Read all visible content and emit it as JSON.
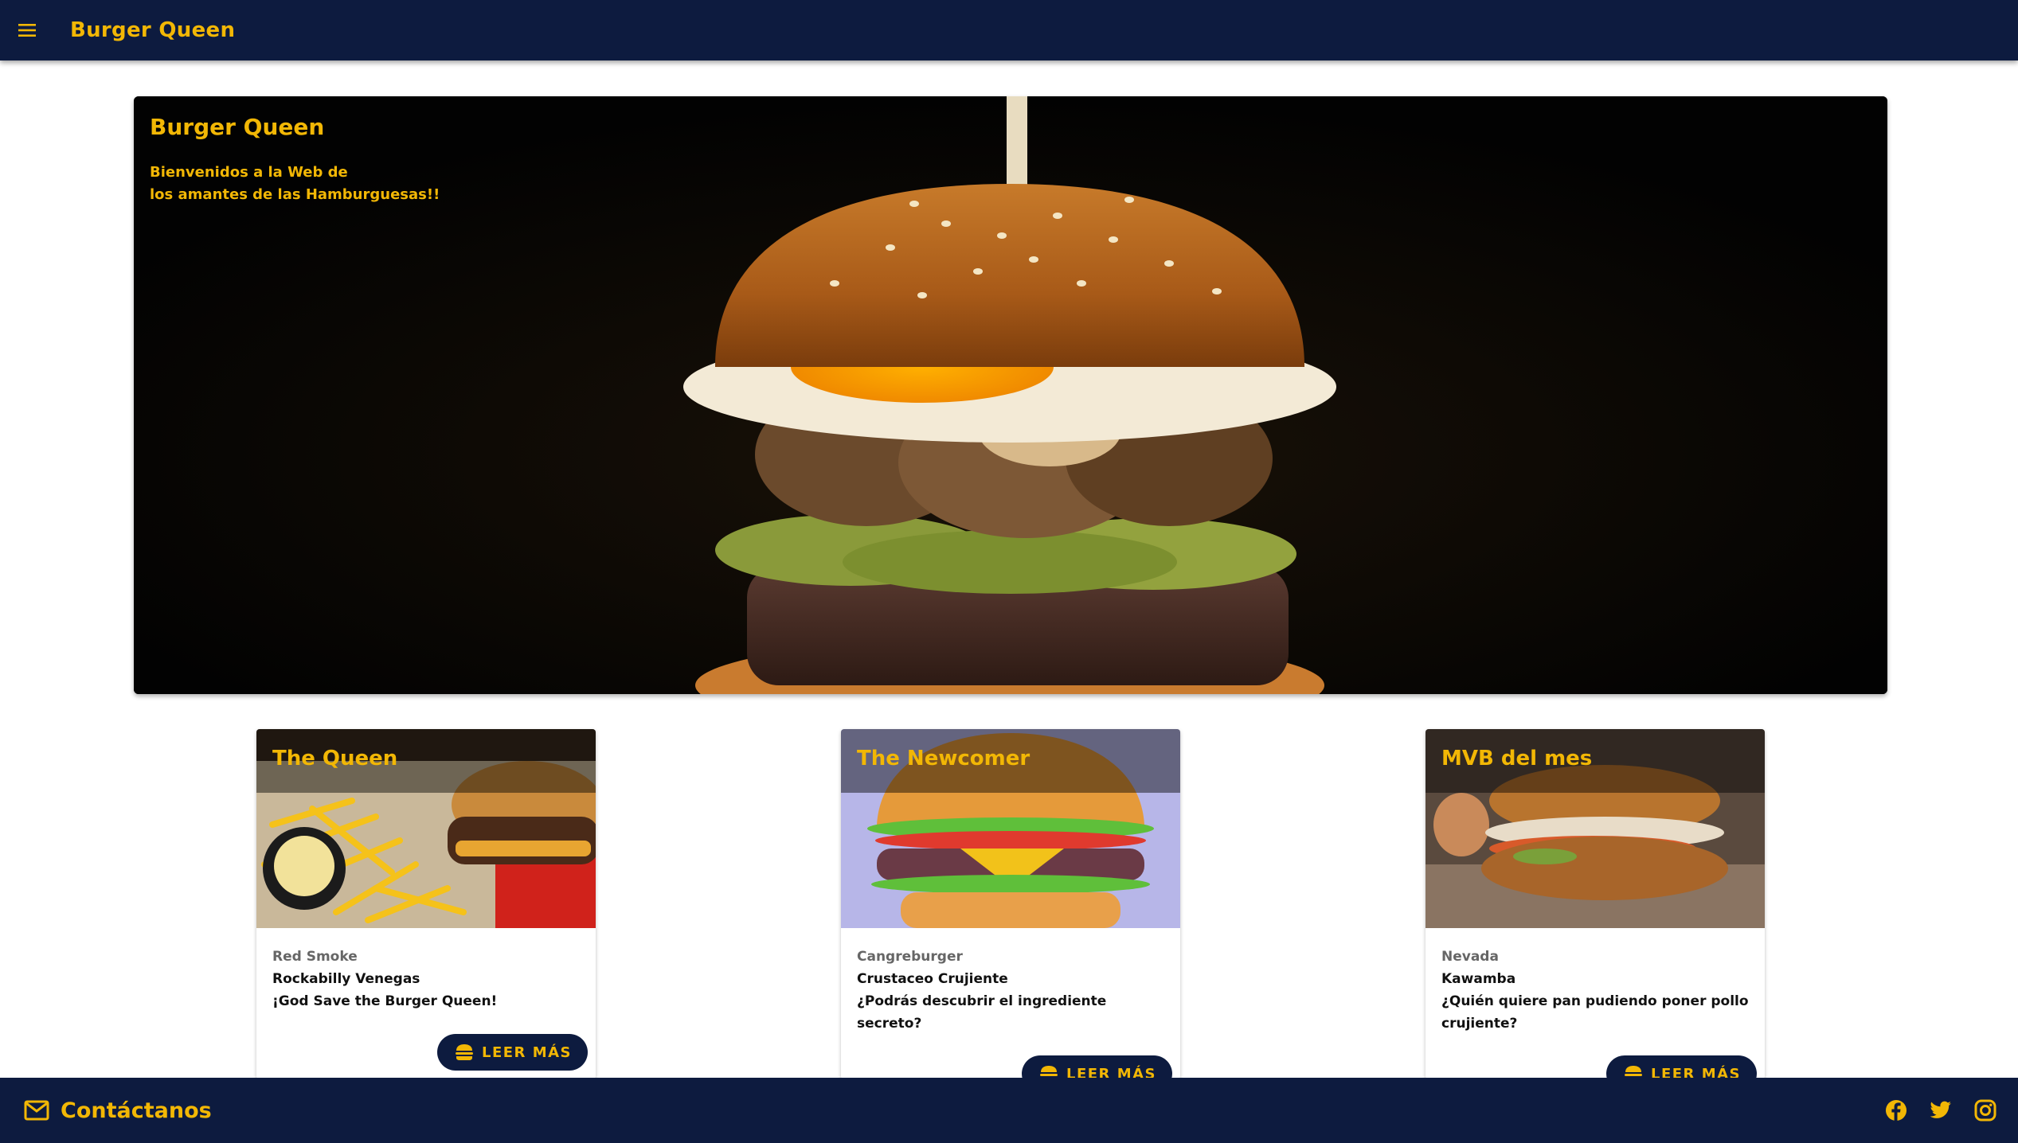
{
  "header": {
    "title": "Burger Queen",
    "menu_icon": "hamburger-menu-icon"
  },
  "hero": {
    "title": "Burger Queen",
    "subtitle_line1": "Bienvenidos a la Web de",
    "subtitle_line2": "los amantes de las Hamburguesas!!"
  },
  "cards": [
    {
      "title": "The Queen",
      "subtitle": "Red Smoke",
      "line1": "Rockabilly Venegas",
      "line2": "¡God Save the Burger Queen!",
      "button": "LEER MÁS"
    },
    {
      "title": "The Newcomer",
      "subtitle": "Cangreburger",
      "line1": "Crustaceo Crujiente",
      "line2": "¿Podrás descubrir el ingrediente secreto?",
      "button": "LEER MÁS"
    },
    {
      "title": "MVB del mes",
      "subtitle": "Nevada",
      "line1": "Kawamba",
      "line2": "¿Quién quiere pan pudiendo poner pollo crujiente?",
      "button": "LEER MÁS"
    }
  ],
  "footer": {
    "contact_label": "Contáctanos",
    "contact_icon": "mail-icon",
    "social_icons": [
      "facebook-icon",
      "twitter-icon",
      "instagram-icon"
    ]
  },
  "colors": {
    "navy": "#0d1b3f",
    "gold": "#f2b705"
  }
}
